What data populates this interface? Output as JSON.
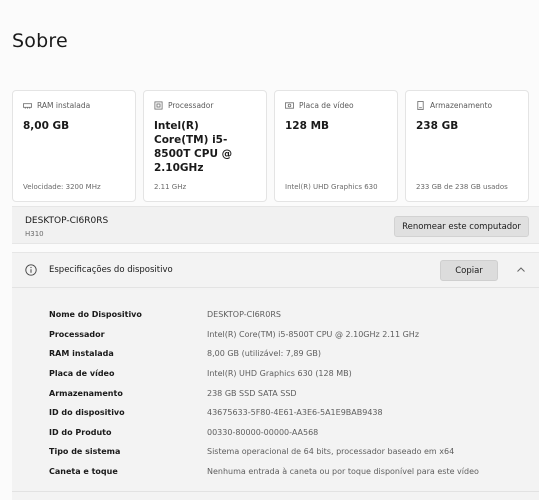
{
  "page": {
    "title": "Sobre"
  },
  "cards": [
    {
      "icon": "ram-icon",
      "label": "RAM instalada",
      "value": "8,00 GB",
      "foot": "Velocidade: 3200 MHz"
    },
    {
      "icon": "processor-icon",
      "label": "Processador",
      "value": "Intel(R) Core(TM) i5-8500T CPU @ 2.10GHz",
      "foot": "2.11 GHz"
    },
    {
      "icon": "video-card-icon",
      "label": "Placa de vídeo",
      "value": "128 MB",
      "foot": "Intel(R) UHD Graphics 630"
    },
    {
      "icon": "storage-icon",
      "label": "Armazenamento",
      "value": "238 GB",
      "foot": "233 GB de 238 GB usados"
    }
  ],
  "device": {
    "name": "DESKTOP-CI6R0RS",
    "model": "H310",
    "rename_label": "Renomear este computador"
  },
  "specs": {
    "title": "Especificações do dispositivo",
    "copy_label": "Copiar",
    "rows": [
      {
        "label": "Nome do Dispositivo",
        "value": "DESKTOP-CI6R0RS"
      },
      {
        "label": "Processador",
        "value": "Intel(R) Core(TM) i5-8500T CPU @ 2.10GHz   2.11 GHz"
      },
      {
        "label": "RAM instalada",
        "value": "8,00 GB (utilizável: 7,89 GB)"
      },
      {
        "label": "Placa de vídeo",
        "value": "Intel(R) UHD Graphics 630 (128 MB)"
      },
      {
        "label": "Armazenamento",
        "value": "238 GB SSD SATA SSD"
      },
      {
        "label": "ID do dispositivo",
        "value": "43675633-5F80-4E61-A3E6-5A1E9BAB9438"
      },
      {
        "label": "ID do Produto",
        "value": "00330-80000-00000-AA568"
      },
      {
        "label": "Tipo de sistema",
        "value": "Sistema operacional de 64 bits, processador baseado em x64"
      },
      {
        "label": "Caneta e toque",
        "value": "Nenhuma entrada à caneta ou por toque disponível para este vídeo"
      }
    ]
  }
}
